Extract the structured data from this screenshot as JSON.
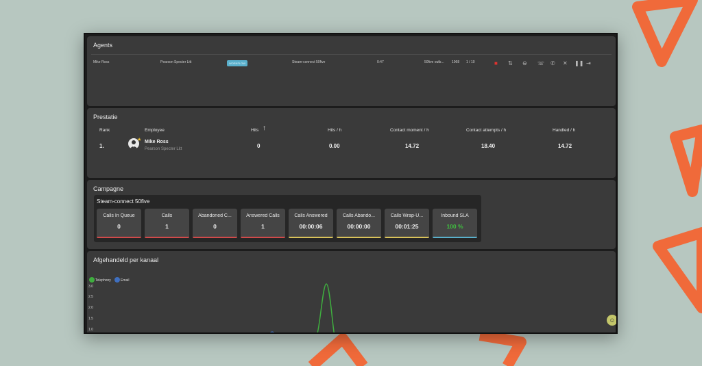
{
  "agents": {
    "title": "Agents",
    "row": {
      "name": "Mike Ross",
      "company": "Pearson Specter Litt",
      "status": "WORKFLOW",
      "campaign": "Steam-connect 50five",
      "time": "0:47",
      "task": "50five outb...",
      "counter": "1068",
      "pages": "1 / 10"
    },
    "controls": [
      "stop-icon",
      "transfer-icon",
      "minus-circle-icon",
      "phone-forward-icon",
      "phone-down-icon",
      "close-icon",
      "pause-icon",
      "logout-icon"
    ]
  },
  "prestatie": {
    "title": "Prestatie",
    "headers": {
      "rank": "Rank",
      "employee": "Employee",
      "hits": "Hits",
      "hits_h": "Hits / h",
      "contact_moment_h": "Contact moment / h",
      "contact_attempts_h": "Contact attempts / h",
      "handled_h": "Handled / h"
    },
    "sort_icon": "arrow-up-icon",
    "row": {
      "rank": "1.",
      "name": "Mike Ross",
      "company": "Pearson Specter Litt",
      "hits": "0",
      "hits_h": "0.00",
      "contact_moment_h": "14.72",
      "contact_attempts_h": "18.40",
      "handled_h": "14.72"
    }
  },
  "campagne": {
    "title": "Campagne",
    "campaign_name": "Steam-connect 50five",
    "stats": [
      {
        "label": "Calls In Queue",
        "value": "0",
        "color": "#d04a4a"
      },
      {
        "label": "Calls",
        "value": "1",
        "color": "#d04a4a"
      },
      {
        "label": "Abandoned C...",
        "value": "0",
        "color": "#d04a4a"
      },
      {
        "label": "Answered Calls",
        "value": "1",
        "color": "#d04a4a"
      },
      {
        "label": "Calls Answered",
        "value": "00:00:06",
        "color": "#d8c25a"
      },
      {
        "label": "Calls Abando...",
        "value": "00:00:00",
        "color": "#d8c25a"
      },
      {
        "label": "Calls Wrap-U...",
        "value": "00:01:25",
        "color": "#d8c25a"
      },
      {
        "label": "Inbound SLA",
        "value": "100 %",
        "color": "#5ab0cc",
        "value_color": "#3fbf3f"
      }
    ]
  },
  "afgehandeld": {
    "title": "Afgehandeld per kanaal"
  },
  "chart_data": {
    "type": "line",
    "title": "Afgehandeld per kanaal",
    "legend_placement": "top-left",
    "yticks": [
      "3.0",
      "2.5",
      "2.0",
      "1.5",
      "1.0"
    ],
    "ylim": [
      1.0,
      3.0
    ],
    "series": [
      {
        "name": "Telephony",
        "color": "#3fae3f"
      },
      {
        "name": "Email",
        "color": "#3f6fbf"
      }
    ]
  },
  "help": {
    "icon": "help-icon"
  }
}
